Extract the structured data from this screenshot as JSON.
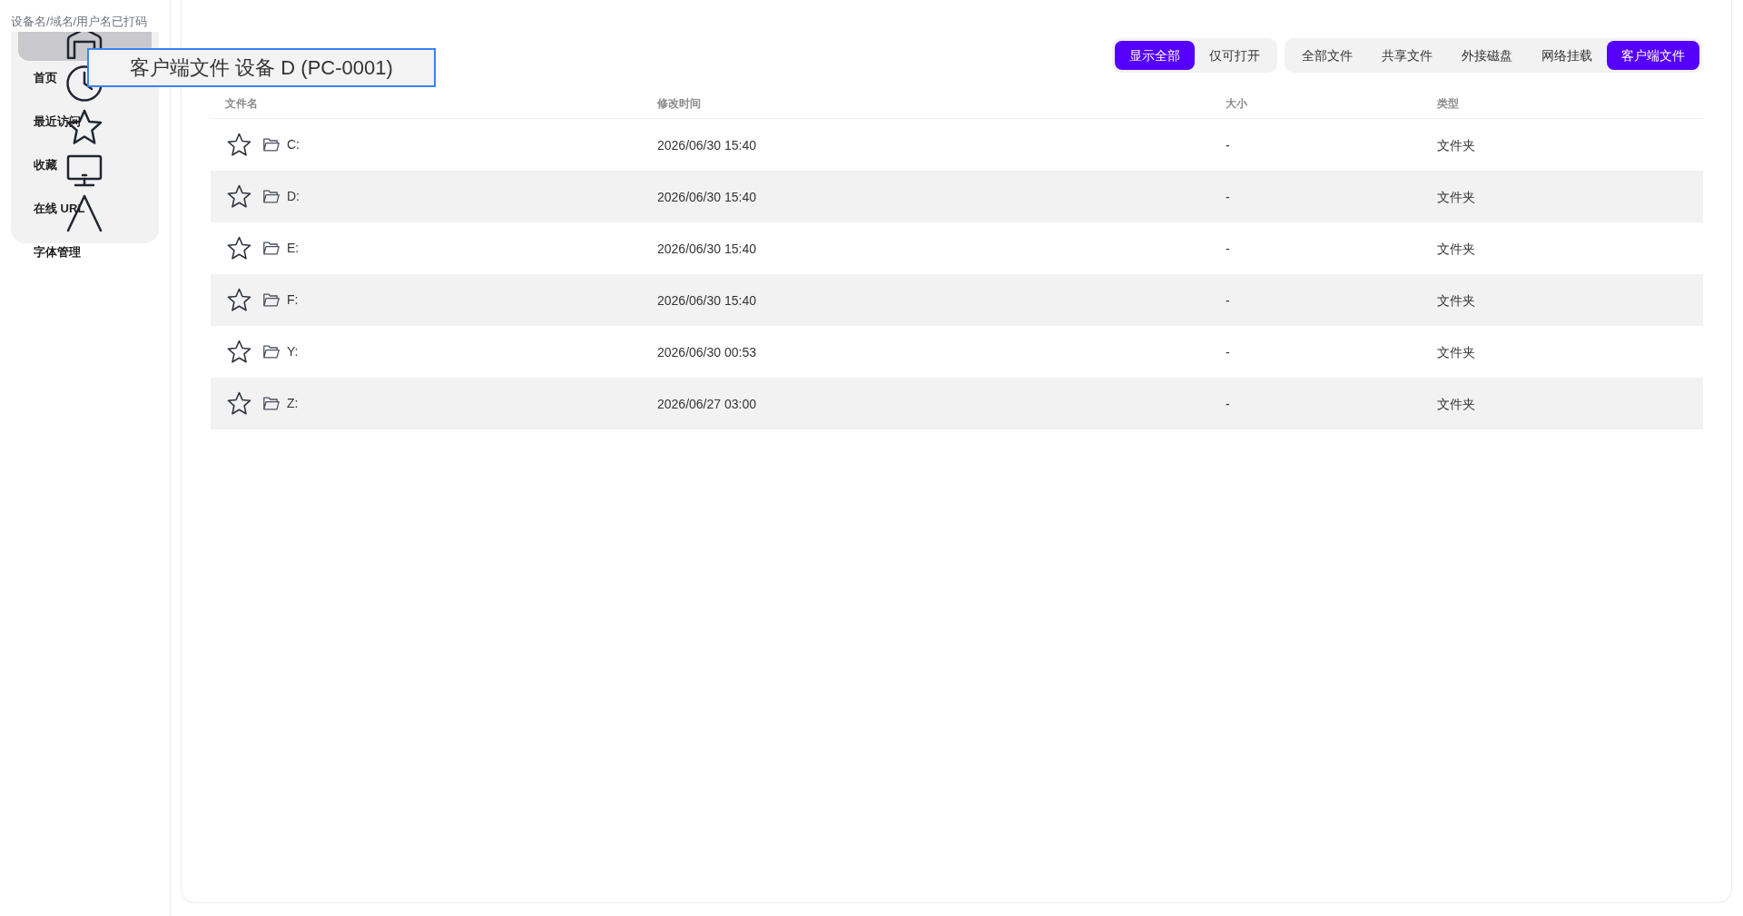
{
  "breadcrumb": "设备名/域名/用户名已打码",
  "sidebar": {
    "items": [
      {
        "label": "首页",
        "selected": true
      },
      {
        "label": "最近访问",
        "selected": false
      },
      {
        "label": "收藏",
        "selected": false
      },
      {
        "label": "在线 URL",
        "selected": false
      },
      {
        "label": "字体管理",
        "selected": false
      }
    ]
  },
  "tooltip": {
    "text": "客户端文件 设备 D (PC-0001)"
  },
  "view_filter": [
    {
      "label": "显示全部",
      "selected": true
    },
    {
      "label": "仅可打开",
      "selected": false
    }
  ],
  "source_tabs": [
    {
      "label": "全部文件",
      "selected": false
    },
    {
      "label": "共享文件",
      "selected": false
    },
    {
      "label": "外接磁盘",
      "selected": false
    },
    {
      "label": "网络挂载",
      "selected": false
    },
    {
      "label": "客户端文件",
      "selected": true
    }
  ],
  "table": {
    "columns": [
      "文件名",
      "修改时间",
      "大小",
      "类型"
    ],
    "rows": [
      {
        "starred": false,
        "name": "C:",
        "modified": "2026/06/30 15:40",
        "size": "-",
        "type": "文件夹"
      },
      {
        "starred": false,
        "name": "D:",
        "modified": "2026/06/30 15:40",
        "size": "-",
        "type": "文件夹"
      },
      {
        "starred": false,
        "name": "E:",
        "modified": "2026/06/30 15:40",
        "size": "-",
        "type": "文件夹"
      },
      {
        "starred": false,
        "name": "F:",
        "modified": "2026/06/30 15:40",
        "size": "-",
        "type": "文件夹"
      },
      {
        "starred": false,
        "name": "Y:",
        "modified": "2026/06/30 00:53",
        "size": "-",
        "type": "文件夹"
      },
      {
        "starred": false,
        "name": "Z:",
        "modified": "2026/06/27 03:00",
        "size": "-",
        "type": "文件夹"
      }
    ]
  }
}
